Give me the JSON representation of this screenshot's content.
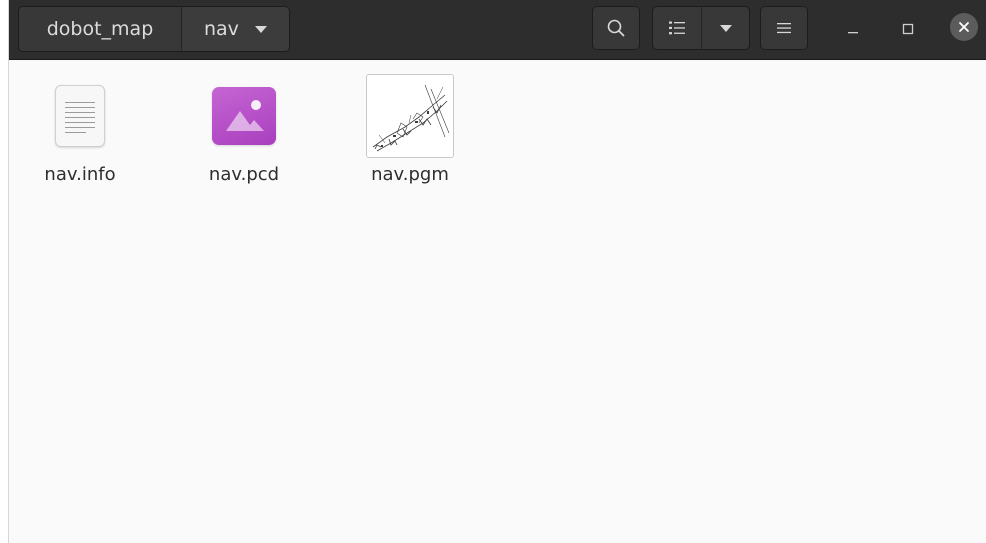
{
  "window": {
    "breadcrumb": [
      {
        "label": "dobot_map"
      },
      {
        "label": "nav"
      }
    ]
  },
  "toolbar": {
    "icons": {
      "search": "search-icon",
      "list_view": "list-view-icon",
      "view_options": "chevron-down-icon",
      "menu": "hamburger-menu-icon",
      "minimize": "minimize-icon",
      "maximize": "maximize-icon",
      "close": "close-icon"
    }
  },
  "files": [
    {
      "name": "nav.info",
      "icon": "text-document-icon"
    },
    {
      "name": "nav.pcd",
      "icon": "image-file-icon"
    },
    {
      "name": "nav.pgm",
      "icon": "map-thumbnail-icon"
    }
  ],
  "colors": {
    "titlebar": "#2d2d2d",
    "content_bg": "#fafafa",
    "image_icon": "#b84fc8",
    "close_button": "#5c5c5c"
  }
}
